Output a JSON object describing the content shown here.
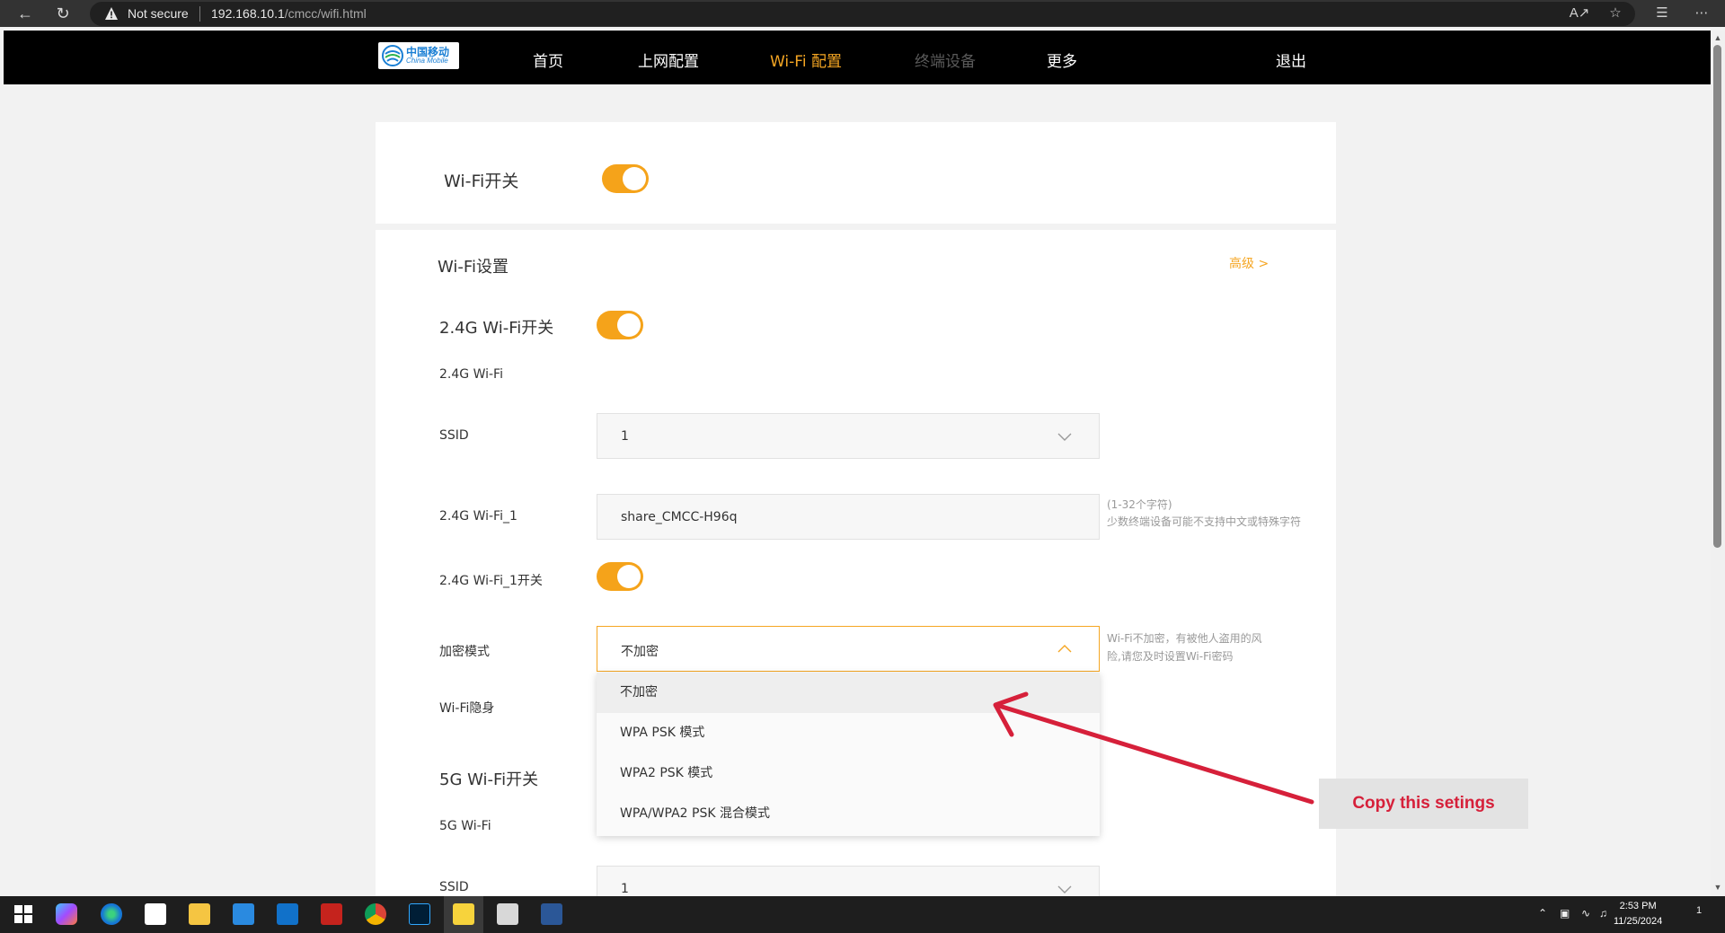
{
  "browser": {
    "security_label": "Not secure",
    "url_host": "192.168.10.1",
    "url_path": "/cmcc/wifi.html"
  },
  "header": {
    "logo_cn": "中国移动",
    "logo_en": "China Mobile",
    "menu": [
      {
        "label": "首页"
      },
      {
        "label": "上网配置"
      },
      {
        "label": "Wi-Fi 配置"
      },
      {
        "label": "终端设备"
      },
      {
        "label": "更多"
      }
    ],
    "logout": "退出"
  },
  "wifi_master": {
    "label": "Wi-Fi开关",
    "enabled": true
  },
  "wifi_settings": {
    "title": "Wi-Fi设置",
    "advanced_link": "高级 >",
    "band24_switch_label": "2.4G Wi-Fi开关",
    "band24_section": "2.4G Wi-Fi",
    "ssid_label": "SSID",
    "ssid_value": "1",
    "ssid_name_label": "2.4G Wi-Fi_1",
    "ssid_name_value": "share_CMCC-H96q",
    "ssid_name_hint_1": "(1-32个字符)",
    "ssid_name_hint_2": "少数终端设备可能不支持中文或特殊字符",
    "ssid_switch_label": "2.4G Wi-Fi_1开关",
    "encryption_label": "加密模式",
    "encryption_value": "不加密",
    "encryption_hint_1": "Wi-Fi不加密，有被他人盗用的风",
    "encryption_hint_2": "险,请您及时设置Wi-Fi密码",
    "encryption_options": [
      "不加密",
      "WPA PSK 模式",
      "WPA2 PSK 模式",
      "WPA/WPA2 PSK 混合模式"
    ],
    "hidden_label": "Wi-Fi隐身",
    "band5_switch_label": "5G Wi-Fi开关",
    "band5_section": "5G Wi-Fi",
    "ssid5_label": "SSID",
    "ssid5_value": "1"
  },
  "annotation": {
    "text": "Copy this setings",
    "color": "#d6203a"
  },
  "taskbar": {
    "time": "2:53 PM",
    "date": "11/25/2024",
    "notification_count": "1"
  },
  "colors": {
    "accent": "#f5a623",
    "toggle_on": "#f5a31a",
    "header_bg": "#000000"
  }
}
